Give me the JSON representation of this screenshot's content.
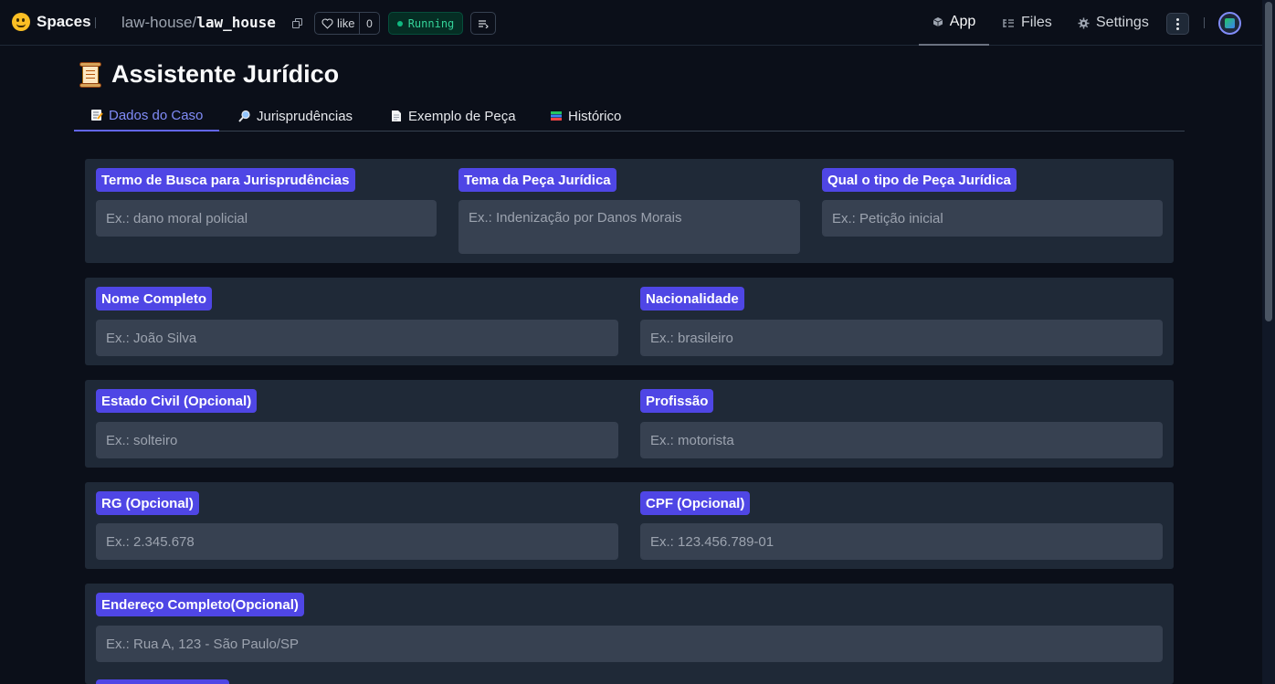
{
  "topbar": {
    "brand": "Spaces",
    "repo_owner": "law-house/",
    "repo_name": "law_house",
    "like_label": "like",
    "like_count": "0",
    "status": "Running",
    "nav": [
      {
        "label": "App",
        "icon": "cube-icon",
        "active": true
      },
      {
        "label": "Files",
        "icon": "files-icon"
      },
      {
        "label": "Settings",
        "icon": "gear-icon"
      }
    ]
  },
  "app": {
    "title": "Assistente Jurídico",
    "tabs": [
      {
        "label": "Dados do Caso",
        "icon": "memo-icon",
        "active": true
      },
      {
        "label": "Jurisprudências",
        "icon": "magnifier-icon"
      },
      {
        "label": "Exemplo de Peça",
        "icon": "page-icon"
      },
      {
        "label": "Histórico",
        "icon": "books-icon"
      }
    ]
  },
  "form": {
    "termo_busca": {
      "label": "Termo de Busca para Jurisprudências",
      "placeholder": "Ex.: dano moral policial"
    },
    "tema_peca": {
      "label": "Tema da Peça Jurídica",
      "placeholder": "Ex.: Indenização por Danos Morais"
    },
    "tipo_peca": {
      "label": "Qual o tipo de Peça Jurídica",
      "placeholder": "Ex.: Petição inicial"
    },
    "nome": {
      "label": "Nome Completo",
      "placeholder": "Ex.: João Silva"
    },
    "nacionalidade": {
      "label": "Nacionalidade",
      "placeholder": "Ex.: brasileiro"
    },
    "estado_civil": {
      "label": "Estado Civil (Opcional)",
      "placeholder": "Ex.: solteiro"
    },
    "profissao": {
      "label": "Profissão",
      "placeholder": "Ex.: motorista"
    },
    "rg": {
      "label": "RG (Opcional)",
      "placeholder": "Ex.: 2.345.678"
    },
    "cpf": {
      "label": "CPF (Opcional)",
      "placeholder": "Ex.: 123.456.789-01"
    },
    "endereco": {
      "label": "Endereço Completo(Opcional)",
      "placeholder": "Ex.: Rua A, 123 - São Paulo/SP"
    }
  }
}
